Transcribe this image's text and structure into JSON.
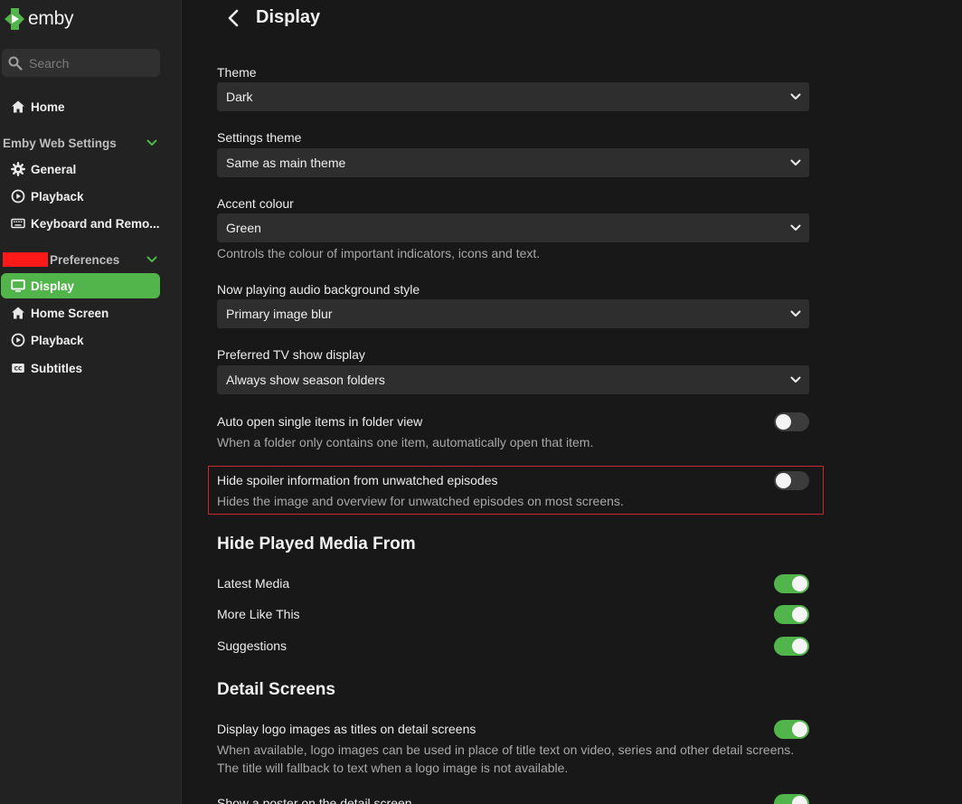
{
  "app": {
    "logo_text": "emby",
    "brand_color": "#52b54b"
  },
  "sidebar": {
    "search_placeholder": "Search",
    "home_label": "Home",
    "web_settings": {
      "title": "Emby Web Settings",
      "items": [
        {
          "label": "General",
          "icon": "gear-icon"
        },
        {
          "label": "Playback",
          "icon": "play-circle-icon"
        },
        {
          "label": "Keyboard and Remo...",
          "icon": "keyboard-icon"
        }
      ]
    },
    "preferences": {
      "title": "Preferences",
      "items": [
        {
          "label": "Display",
          "icon": "monitor-icon",
          "active": true
        },
        {
          "label": "Home Screen",
          "icon": "home-icon"
        },
        {
          "label": "Playback",
          "icon": "play-circle-icon"
        },
        {
          "label": "Subtitles",
          "icon": "subtitles-icon"
        }
      ]
    }
  },
  "page": {
    "title": "Display"
  },
  "settings": {
    "theme": {
      "label": "Theme",
      "value": "Dark"
    },
    "settings_theme": {
      "label": "Settings theme",
      "value": "Same as main theme"
    },
    "accent": {
      "label": "Accent colour",
      "value": "Green",
      "desc": "Controls the colour of important indicators, icons and text."
    },
    "now_playing": {
      "label": "Now playing audio background style",
      "value": "Primary image blur"
    },
    "tv_display": {
      "label": "Preferred TV show display",
      "value": "Always show season folders"
    },
    "auto_open": {
      "label": "Auto open single items in folder view",
      "desc": "When a folder only contains one item, automatically open that item.",
      "on": false
    },
    "hide_spoiler": {
      "label": "Hide spoiler information from unwatched episodes",
      "desc": "Hides the image and overview for unwatched episodes on most screens.",
      "on": false
    }
  },
  "hide_played": {
    "title": "Hide Played Media From",
    "items": [
      {
        "label": "Latest Media",
        "on": true
      },
      {
        "label": "More Like This",
        "on": true
      },
      {
        "label": "Suggestions",
        "on": true
      }
    ]
  },
  "detail_screens": {
    "title": "Detail Screens",
    "logo_titles": {
      "label": "Display logo images as titles on detail screens",
      "desc1": "When available, logo images can be used in place of title text on video, series and other detail screens.",
      "desc2": "The title will fallback to text when a logo image is not available.",
      "on": true
    },
    "poster": {
      "label": "Show a poster on the detail screen",
      "on": true
    }
  }
}
